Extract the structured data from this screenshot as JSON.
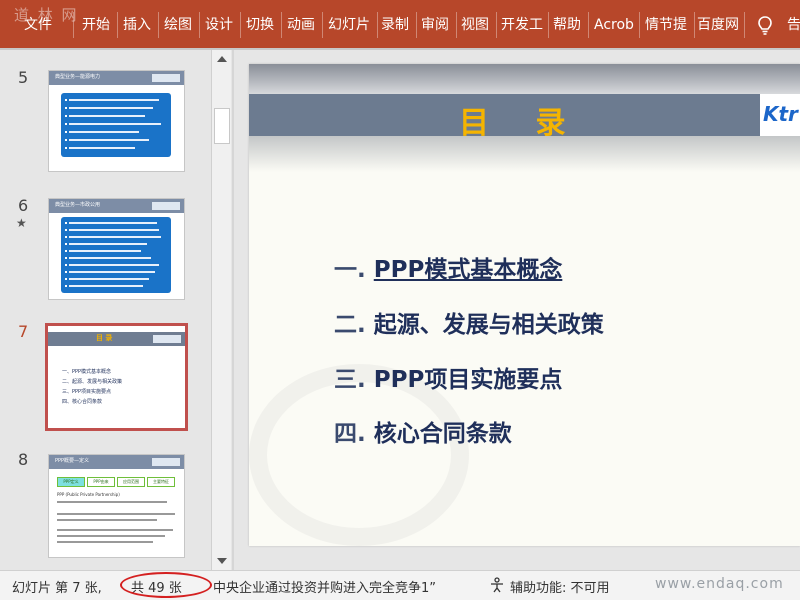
{
  "ribbon": {
    "color": "#b7472a",
    "watermark": "道 林 网",
    "tabs": [
      "文件",
      "开始",
      "插入",
      "绘图",
      "设计",
      "切换",
      "动画",
      "幻灯片",
      "录制",
      "审阅",
      "视图",
      "开发工",
      "帮助",
      "Acrob",
      "情节提",
      "百度网"
    ],
    "tell_me": "告"
  },
  "thumbnails": [
    {
      "number": "5",
      "title": "典型业务—能源电力",
      "icon": "none"
    },
    {
      "number": "6",
      "title": "典型业务—市政公用",
      "icon": "star-icon"
    },
    {
      "number": "7",
      "title": "目  录",
      "items": [
        "一、PPP模式基本概念",
        "二、起源、发展与相关政策",
        "三、PPP项目实施要点",
        "四、核心合同条款"
      ],
      "selected": true
    },
    {
      "number": "8",
      "title": "PPP概要—定义",
      "tabs": [
        "PPP定义",
        "PPP由来",
        "应用范围",
        "主要特征"
      ],
      "caption": "PPP (Public Private Partnership)"
    }
  ],
  "slide": {
    "title": "目 录",
    "logo": "Ktr",
    "title_color": "#f5b400",
    "items": [
      {
        "num": "一.",
        "text": "PPP模式基本概念",
        "link": true
      },
      {
        "num": "二.",
        "text": "起源、发展与相关政策",
        "link": false
      },
      {
        "num": "三.",
        "text": "PPP项目实施要点",
        "link": false
      },
      {
        "num": "四.",
        "text": "核心合同条款",
        "link": false
      }
    ]
  },
  "status": {
    "slide_prefix": "幻灯片 第 7 张,",
    "slide_total": "共 49 张",
    "notes_text": "中央企业通过投资并购进入完全竞争1”",
    "accessibility": "辅助功能: 不可用",
    "watermark": "www.endaq.com",
    "highlight_color": "#d42020"
  }
}
